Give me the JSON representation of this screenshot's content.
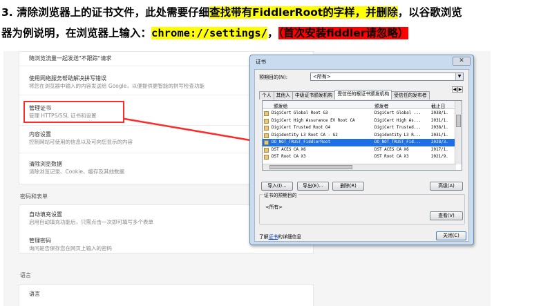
{
  "heading": {
    "line1_prefix": "3. 清除浏览器上的证书文件，此处需要仔细",
    "line1_highlight": "查找带有FiddlerRoot的字样，并删除",
    "line1_suffix": "，以谷歌浏览",
    "line2_prefix": "器为例说明，在浏览器上输入：",
    "line2_url": "chrome://settings/",
    "line2_comma": "，",
    "line2_note": "（首次安装fiddler请忽略）",
    "colors": {
      "yellow_highlight": "#ffff00",
      "red_highlight": "#ff0000"
    }
  },
  "settings": {
    "items": [
      {
        "title": "随浏览流量一起发送\"不跟踪\"请求",
        "desc": ""
      },
      {
        "title": "使用网络服务帮助解决拼写错误",
        "desc": "将您在浏览器中输入的内容发送给 Google，以便提供更智能的拼写检查功能"
      },
      {
        "title": "管理证书",
        "desc": "管理 HTTPS/SSL 证书和设置"
      },
      {
        "title": "内容设置",
        "desc": "控制网站可使用的信息以及可向您显示的内容"
      },
      {
        "title": "清除浏览数据",
        "desc": "清除浏览记录、Cookie、缓存及其他数据"
      }
    ],
    "section_passwords": "密码和表单",
    "password_items": [
      {
        "title": "自动填充设置",
        "desc": "启用自动填充功能后，只需点击一次即可填写多个表单"
      },
      {
        "title": "管理密码",
        "desc": "询问是否保存您在网页上输入的密码"
      }
    ],
    "section_language": "语言",
    "language_item": "语言"
  },
  "dialog": {
    "title": "证书",
    "close_glyph": "✕",
    "purpose_label": "预期目的(N):",
    "purpose_value": "<所有>",
    "tabs": [
      "个人",
      "其他人",
      "中级证书颁发机构",
      "受信任的根证书颁发机构",
      "受信任的发布者"
    ],
    "active_tab": 3,
    "nav_left": "◀",
    "nav_right": "▶",
    "columns": [
      "颁发给",
      "颁发者",
      "截止日"
    ],
    "rows": [
      {
        "issued_to": "DigiCert Global Root G3",
        "issued_by": "DigiCert Global ...",
        "expires": "2038/1."
      },
      {
        "issued_to": "DigiCert High Assurance EV Root CA",
        "issued_by": "DigiCert High As...",
        "expires": "2031/1."
      },
      {
        "issued_to": "DigiCert Trusted Root G4",
        "issued_by": "DigiCert Trusted...",
        "expires": "2038/1."
      },
      {
        "issued_to": "Digidentity L3 Root CA - G2",
        "issued_by": "Digidentity L3 R...",
        "expires": "2031/1."
      },
      {
        "issued_to": "DO_NOT_TRUST_FiddlerRoot",
        "issued_by": "DO_NOT_TRUST_Fid...",
        "expires": "2028/3."
      },
      {
        "issued_to": "DST ACES CA X6",
        "issued_by": "DST ACES CA X6",
        "expires": "2017/1."
      },
      {
        "issued_to": "DST Root CA X3",
        "issued_by": "DST Root CA X3",
        "expires": "2021/9."
      }
    ],
    "selected_row": 4,
    "buttons": {
      "import": "导入(I)...",
      "export": "导出(E)...",
      "delete": "删除(R)",
      "advanced": "高级(A)",
      "view": "查看(V)",
      "close": "关闭(C)"
    },
    "purposes_group_title": "证书的预期目的",
    "purposes_group_value": "<所有>",
    "learn_more_prefix": "了解",
    "learn_more_link": "证书",
    "learn_more_suffix": "的详细信息"
  },
  "annotation_colors": {
    "red_box": "#ff2a2a",
    "arrow": "#ff2a2a",
    "selection": "#1e6ee6"
  }
}
